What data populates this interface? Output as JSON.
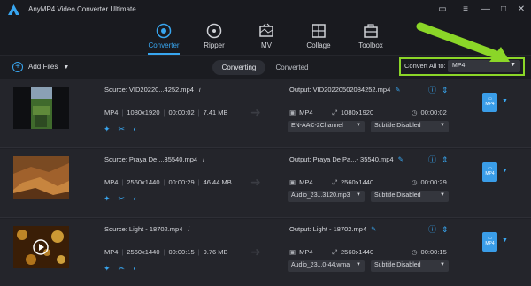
{
  "app": {
    "title": "AnyMP4 Video Converter Ultimate"
  },
  "window_controls": [
    "chat-icon",
    "menu-icon",
    "minimize-icon",
    "maximize-icon",
    "close-icon"
  ],
  "nav": {
    "tabs": [
      {
        "label": "Converter",
        "icon": "converter-icon",
        "active": true
      },
      {
        "label": "Ripper",
        "icon": "ripper-icon",
        "active": false
      },
      {
        "label": "MV",
        "icon": "mv-icon",
        "active": false
      },
      {
        "label": "Collage",
        "icon": "collage-icon",
        "active": false
      },
      {
        "label": "Toolbox",
        "icon": "toolbox-icon",
        "active": false
      }
    ]
  },
  "toolbar": {
    "add_files": "Add Files",
    "tab_converting": "Converting",
    "tab_converted": "Converted",
    "convert_all_label": "Convert All to:",
    "convert_all_value": "MP4"
  },
  "colors": {
    "accent": "#38a6f0",
    "highlight": "#8bd628",
    "background": "#1f2026"
  },
  "files": [
    {
      "source": "Source: VID20220...4252.mp4",
      "format": "MP4",
      "resolution": "1080x1920",
      "duration": "00:00:02",
      "size": "7.41 MB",
      "output": "Output: VID20220502084252.mp4",
      "out_format": "MP4",
      "out_resolution": "1080x1920",
      "out_duration": "00:00:02",
      "audio": "EN-AAC-2Channel",
      "subtitle": "Subtitle Disabled",
      "badge": "MP4"
    },
    {
      "source": "Source: Praya De ...35540.mp4",
      "format": "MP4",
      "resolution": "2560x1440",
      "duration": "00:00:29",
      "size": "46.44 MB",
      "output": "Output: Praya De Pa...- 35540.mp4",
      "out_format": "MP4",
      "out_resolution": "2560x1440",
      "out_duration": "00:00:29",
      "audio": "Audio_23...3120.mp3",
      "subtitle": "Subtitle Disabled",
      "badge": "MP4"
    },
    {
      "source": "Source: Light - 18702.mp4",
      "format": "MP4",
      "resolution": "2560x1440",
      "duration": "00:00:15",
      "size": "9.76 MB",
      "output": "Output: Light - 18702.mp4",
      "out_format": "MP4",
      "out_resolution": "2560x1440",
      "out_duration": "00:00:15",
      "audio": "Audio_23...0-44.wma",
      "subtitle": "Subtitle Disabled",
      "badge": "MP4"
    }
  ]
}
